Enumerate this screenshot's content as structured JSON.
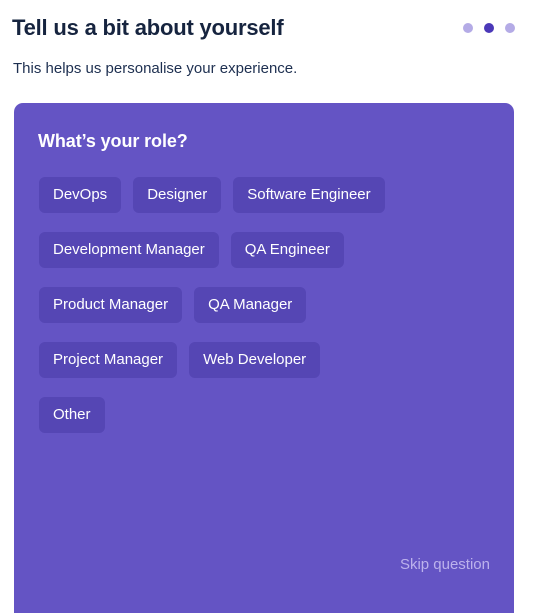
{
  "header": {
    "title": "Tell us a bit about yourself",
    "subtitle": "This helps us personalise your experience.",
    "step_dots": [
      {
        "name": "step-dot-1",
        "active": false,
        "color": "#b4abe6"
      },
      {
        "name": "step-dot-2",
        "active": true,
        "color": "#4b38b8"
      },
      {
        "name": "step-dot-3",
        "active": false,
        "color": "#b4abe6"
      }
    ]
  },
  "card": {
    "background_color": "#6454c4",
    "chip_color": "#5546b4",
    "question": "What’s your role?",
    "chip_rows": [
      [
        "DevOps",
        "Designer",
        "Software Engineer"
      ],
      [
        "Development Manager",
        "QA Engineer"
      ],
      [
        "Product Manager",
        "QA Manager"
      ],
      [
        "Project Manager",
        "Web Developer"
      ],
      [
        "Other"
      ]
    ],
    "skip_label": "Skip question",
    "skip_color": "#bcb2ec"
  }
}
